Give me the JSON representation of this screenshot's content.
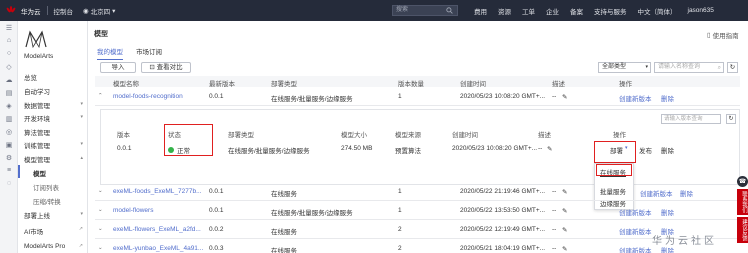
{
  "topbar": {
    "brand": "华为云",
    "console": "控制台",
    "region": "北京四",
    "search_placeholder": "搜索",
    "right_items": [
      "费用",
      "资源",
      "工单",
      "企业",
      "备案",
      "支持与服务",
      "中文（简体）",
      "jason635"
    ]
  },
  "nav": {
    "title": "ModelArts",
    "items": [
      {
        "label": "总览"
      },
      {
        "label": "自动学习"
      },
      {
        "label": "数据管理"
      },
      {
        "label": "开发环境"
      },
      {
        "label": "算法管理"
      },
      {
        "label": "训练管理"
      },
      {
        "label": "模型管理"
      },
      {
        "label": "模型"
      },
      {
        "label": "订阅列表"
      },
      {
        "label": "压缩/转换"
      },
      {
        "label": "部署上线"
      },
      {
        "label": "AI市场"
      },
      {
        "label": "ModelArts Pro"
      }
    ]
  },
  "main": {
    "title": "模型",
    "help": "使用指南",
    "tabs": [
      "我的模型",
      "市场订阅"
    ],
    "import_btn": "导入",
    "compare_btn": "查看对比",
    "filter_value": "全部类型",
    "search_placeholder": "请输入名称查询",
    "columns": [
      "模型名称",
      "最新版本",
      "部署类型",
      "版本数量",
      "创建时间",
      "描述",
      "操作"
    ],
    "rows": [
      {
        "name": "model-foods-recognition",
        "version": "0.0.1",
        "deploy": "在线服务/批量服务/边缘服务",
        "count": "1",
        "created": "2020/05/23 10:08:20 GMT+...",
        "desc": "--",
        "ops": [
          "创建新版本",
          "删除"
        ],
        "expanded": true
      },
      {
        "name": "exeML-foods_ExeML_7277b...",
        "version": "0.0.1",
        "deploy": "在线服务",
        "count": "1",
        "created": "2020/05/22 21:19:46 GMT+...",
        "desc": "--",
        "ops": [
          "创建新版本",
          "删除"
        ]
      },
      {
        "name": "model-flowers",
        "version": "0.0.1",
        "deploy": "在线服务/批量服务/边缘服务",
        "count": "1",
        "created": "2020/05/22 13:53:50 GMT+...",
        "desc": "--",
        "ops": [
          "创建新版本",
          "删除"
        ]
      },
      {
        "name": "exeML-flowers_ExeML_a2fd...",
        "version": "0.0.2",
        "deploy": "在线服务",
        "count": "2",
        "created": "2020/05/22 12:19:49 GMT+...",
        "desc": "--",
        "ops": [
          "创建新版本",
          "删除"
        ]
      },
      {
        "name": "exeML-yunbao_ExeML_4a91...",
        "version": "0.0.3",
        "deploy": "在线服务",
        "count": "2",
        "created": "2020/05/21 18:04:19 GMT+...",
        "desc": "--",
        "ops": [
          "创建新版本",
          "删除"
        ]
      }
    ],
    "sub": {
      "search_placeholder": "请输入版本查询",
      "columns": [
        "版本",
        "状态",
        "部署类型",
        "模型大小",
        "模型来源",
        "创建时间",
        "描述",
        "操作"
      ],
      "row": {
        "version": "0.0.1",
        "status": "正常",
        "deploy": "在线服务/批量服务/边缘服务",
        "size": "274.50 MB",
        "source": "预置算法",
        "created": "2020/05/23 10:08:20 GMT+...",
        "desc": "--",
        "ops": [
          "部署",
          "发布",
          "删除"
        ]
      }
    },
    "deploy_menu": [
      "在线服务",
      "批量服务",
      "边缘服务"
    ]
  },
  "floatbar": [
    "联系我们",
    "建议反馈"
  ],
  "watermark": "华为云社区"
}
